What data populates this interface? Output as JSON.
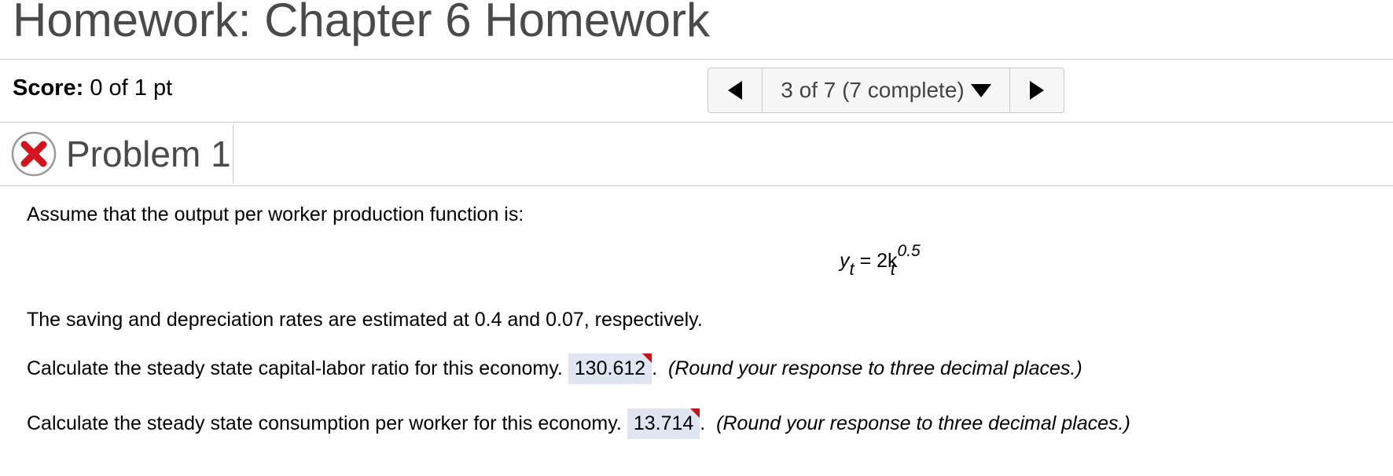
{
  "header": {
    "title": "Homework: Chapter 6 Homework"
  },
  "score": {
    "label": "Score:",
    "value": "0 of 1 pt"
  },
  "nav": {
    "position": "3 of 7 (7 complete)",
    "prev_icon": "triangle-left-icon",
    "next_icon": "triangle-right-icon",
    "dropdown_icon": "triangle-down-icon"
  },
  "problem": {
    "status_icon": "incorrect-x-icon",
    "status_color": "#d2141e",
    "label": "Problem 1"
  },
  "question": {
    "intro": "Assume that the output per worker production function is:",
    "formula": {
      "lhs": "y",
      "lhs_sub": "t",
      "eq": " = 2k",
      "exp": "0.5",
      "rhs_sub": "t"
    },
    "rates_text": "The saving and depreciation rates are estimated at 0.4 and 0.07, respectively.",
    "part1": {
      "prompt": "Calculate the steady state capital-labor ratio for this economy.",
      "answer": "130.612",
      "suffix": ".",
      "hint": "(Round your response to three decimal places.)"
    },
    "part2": {
      "prompt": "Calculate the steady state consumption per worker for this economy.",
      "answer": "13.714",
      "suffix": ".",
      "hint": "(Round your response to three decimal places.)"
    }
  },
  "colors": {
    "answer_bg": "#dfe6f1",
    "incorrect_flag": "#c3151d",
    "divider": "#c8cbd6"
  }
}
